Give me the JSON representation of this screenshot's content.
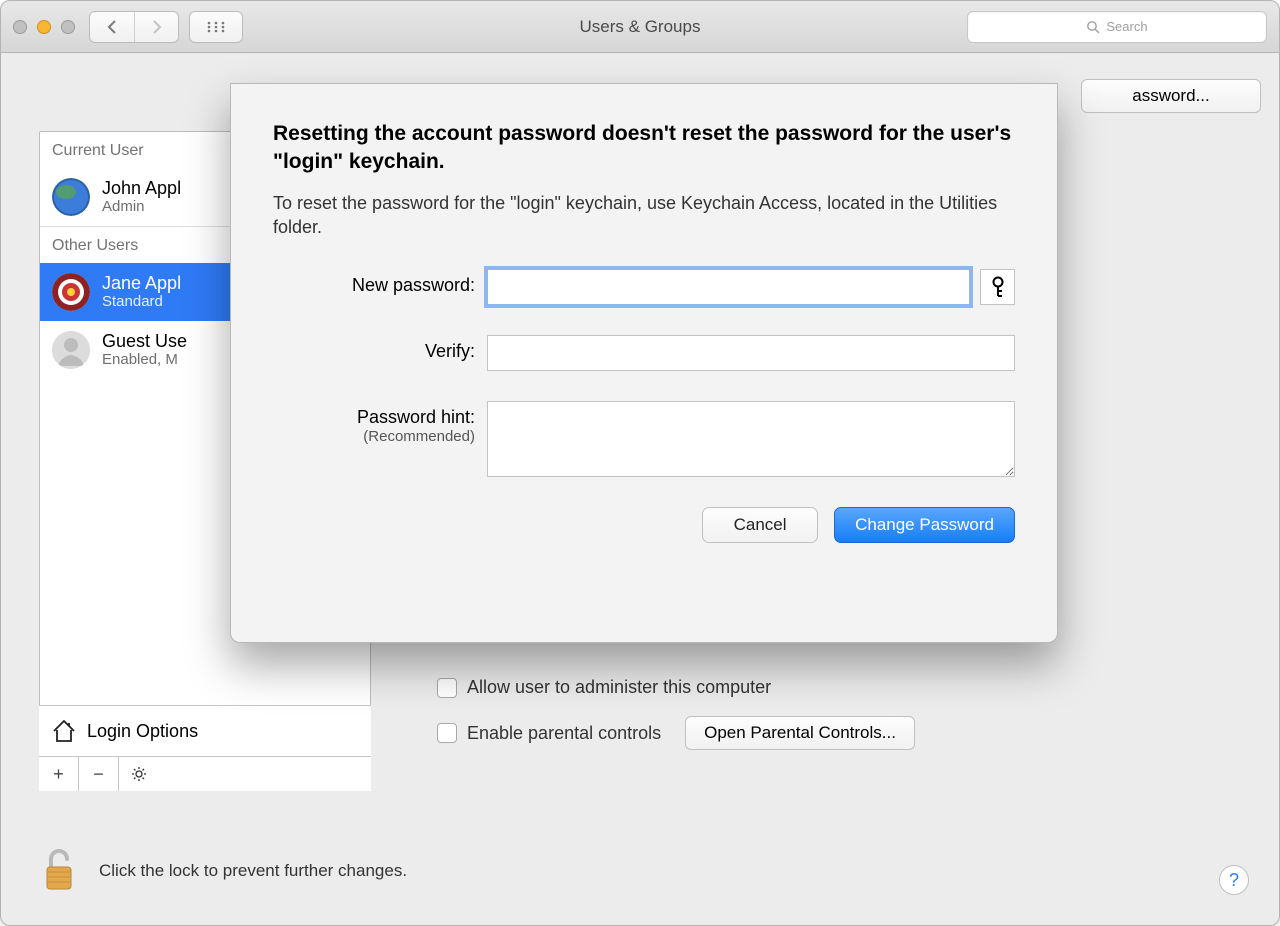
{
  "titlebar": {
    "title": "Users & Groups",
    "search_placeholder": "Search"
  },
  "sidebar": {
    "current_label": "Current User",
    "other_label": "Other Users",
    "login_options": "Login Options",
    "users": [
      {
        "name": "John Appl",
        "role": "Admin"
      },
      {
        "name": "Jane Appl",
        "role": "Standard"
      },
      {
        "name": "Guest Use",
        "role": "Enabled, M"
      }
    ]
  },
  "rightpanel": {
    "reset_button": "assword...",
    "check_admin": "Allow user to administer this computer",
    "check_parental": "Enable parental controls",
    "open_parental": "Open Parental Controls..."
  },
  "lock_text": "Click the lock to prevent further changes.",
  "sheet": {
    "heading": "Resetting the account password doesn't reset the password for the user's \"login\" keychain.",
    "subtext": "To reset the password for the \"login\" keychain, use Keychain Access, located in the Utilities folder.",
    "label_new": "New password:",
    "label_verify": "Verify:",
    "label_hint": "Password hint:",
    "label_hint_sub": "(Recommended)",
    "cancel": "Cancel",
    "change": "Change Password"
  }
}
